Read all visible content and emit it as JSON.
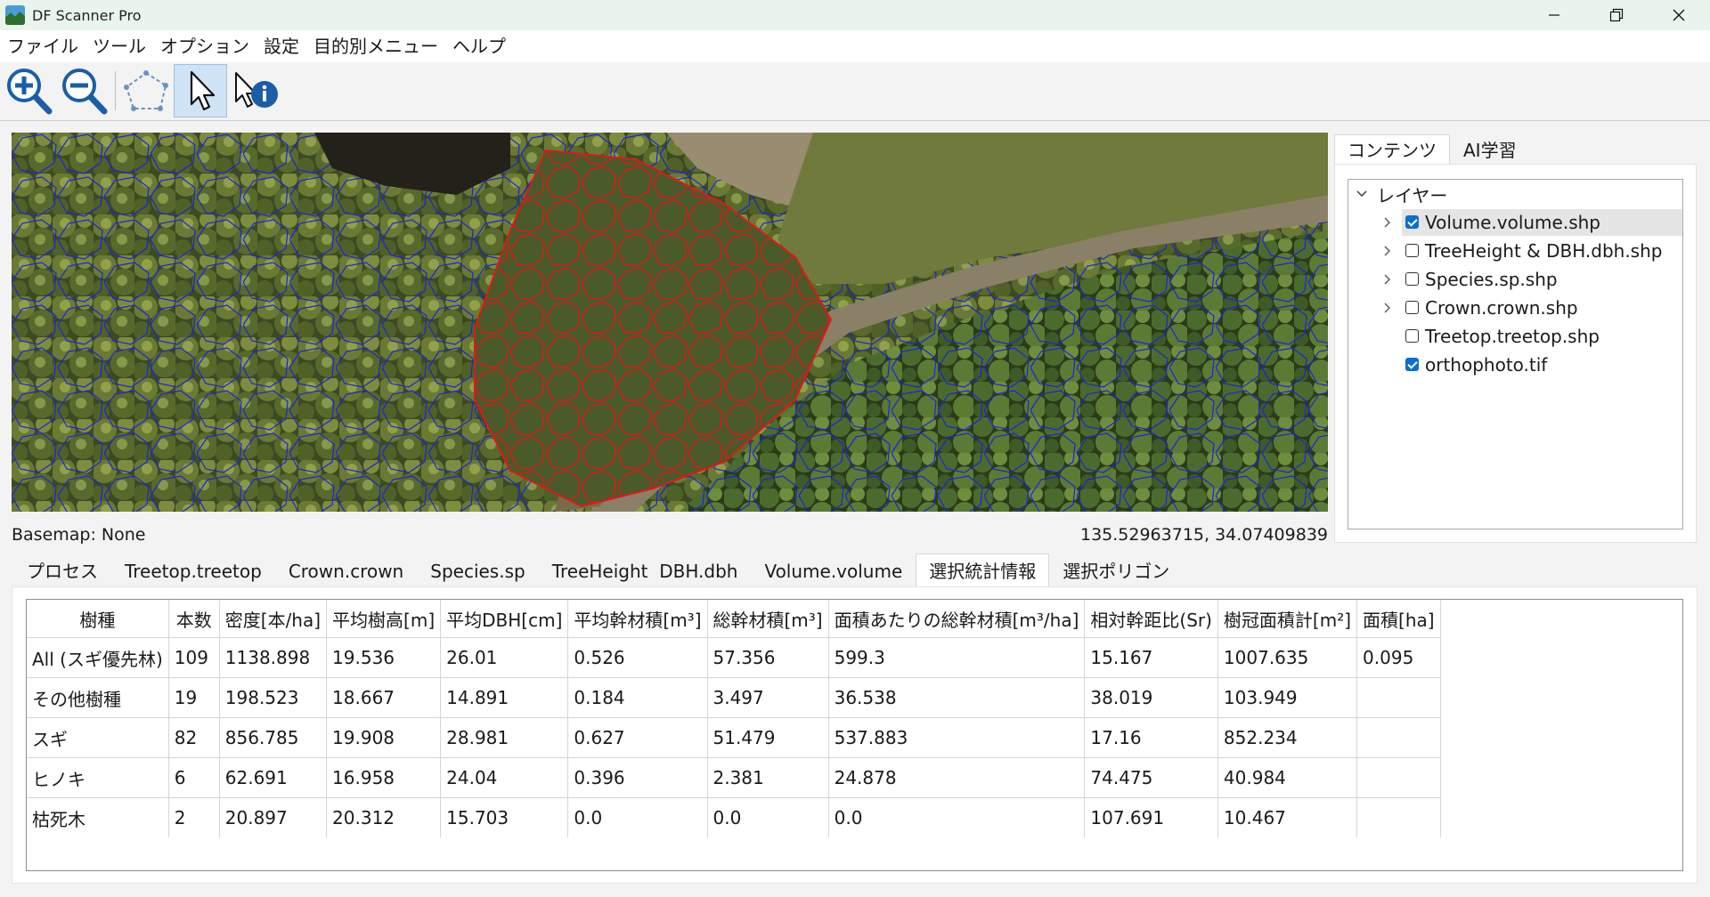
{
  "window": {
    "title": "DF Scanner Pro"
  },
  "menu": [
    "ファイル",
    "ツール",
    "オプション",
    "設定",
    "目的別メニュー",
    "ヘルプ"
  ],
  "toolbar": {
    "tools": [
      "zoom-in",
      "zoom-out",
      "polygon-select",
      "pointer",
      "identify"
    ],
    "active": "pointer"
  },
  "map": {
    "basemap_label": "Basemap: None",
    "coordinates": "135.52963715, 34.07409839",
    "selected_outline_color": "#e01818",
    "crown_outline_color": "#1a24d6"
  },
  "side": {
    "tabs": [
      "コンテンツ",
      "AI学習"
    ],
    "active_tab": 0,
    "root_label": "レイヤー",
    "layers": [
      {
        "name": "Volume.volume.shp",
        "checked": true,
        "expandable": true,
        "selected": true
      },
      {
        "name": "TreeHeight & DBH.dbh.shp",
        "checked": false,
        "expandable": true,
        "selected": false
      },
      {
        "name": "Species.sp.shp",
        "checked": false,
        "expandable": true,
        "selected": false
      },
      {
        "name": "Crown.crown.shp",
        "checked": false,
        "expandable": true,
        "selected": false
      },
      {
        "name": "Treetop.treetop.shp",
        "checked": false,
        "expandable": false,
        "selected": false
      },
      {
        "name": "orthophoto.tif",
        "checked": true,
        "expandable": false,
        "selected": false
      }
    ]
  },
  "bottom": {
    "tabs": [
      "プロセス",
      "Treetop.treetop",
      "Crown.crown",
      "Species.sp",
      "TreeHeight  DBH.dbh",
      "Volume.volume",
      "選択統計情報",
      "選択ポリゴン"
    ],
    "active_tab": 6,
    "table": {
      "columns": [
        "樹種",
        "本数",
        "密度[本/ha]",
        "平均樹高[m]",
        "平均DBH[cm]",
        "平均幹材積[m³]",
        "総幹材積[m³]",
        "面積あたりの総幹材積[m³/ha]",
        "相対幹距比(Sr)",
        "樹冠面積計[m²]",
        "面積[ha]"
      ],
      "rows": [
        [
          "All (スギ優先林)",
          "109",
          "1138.898",
          "19.536",
          "26.01",
          "0.526",
          "57.356",
          "599.3",
          "15.167",
          "1007.635",
          "0.095"
        ],
        [
          "その他樹種",
          "19",
          "198.523",
          "18.667",
          "14.891",
          "0.184",
          "3.497",
          "36.538",
          "38.019",
          "103.949",
          ""
        ],
        [
          "スギ",
          "82",
          "856.785",
          "19.908",
          "28.981",
          "0.627",
          "51.479",
          "537.883",
          "17.16",
          "852.234",
          ""
        ],
        [
          "ヒノキ",
          "6",
          "62.691",
          "16.958",
          "24.04",
          "0.396",
          "2.381",
          "24.878",
          "74.475",
          "40.984",
          ""
        ],
        [
          "枯死木",
          "2",
          "20.897",
          "20.312",
          "15.703",
          "0.0",
          "0.0",
          "0.0",
          "107.691",
          "10.467",
          ""
        ]
      ]
    }
  }
}
